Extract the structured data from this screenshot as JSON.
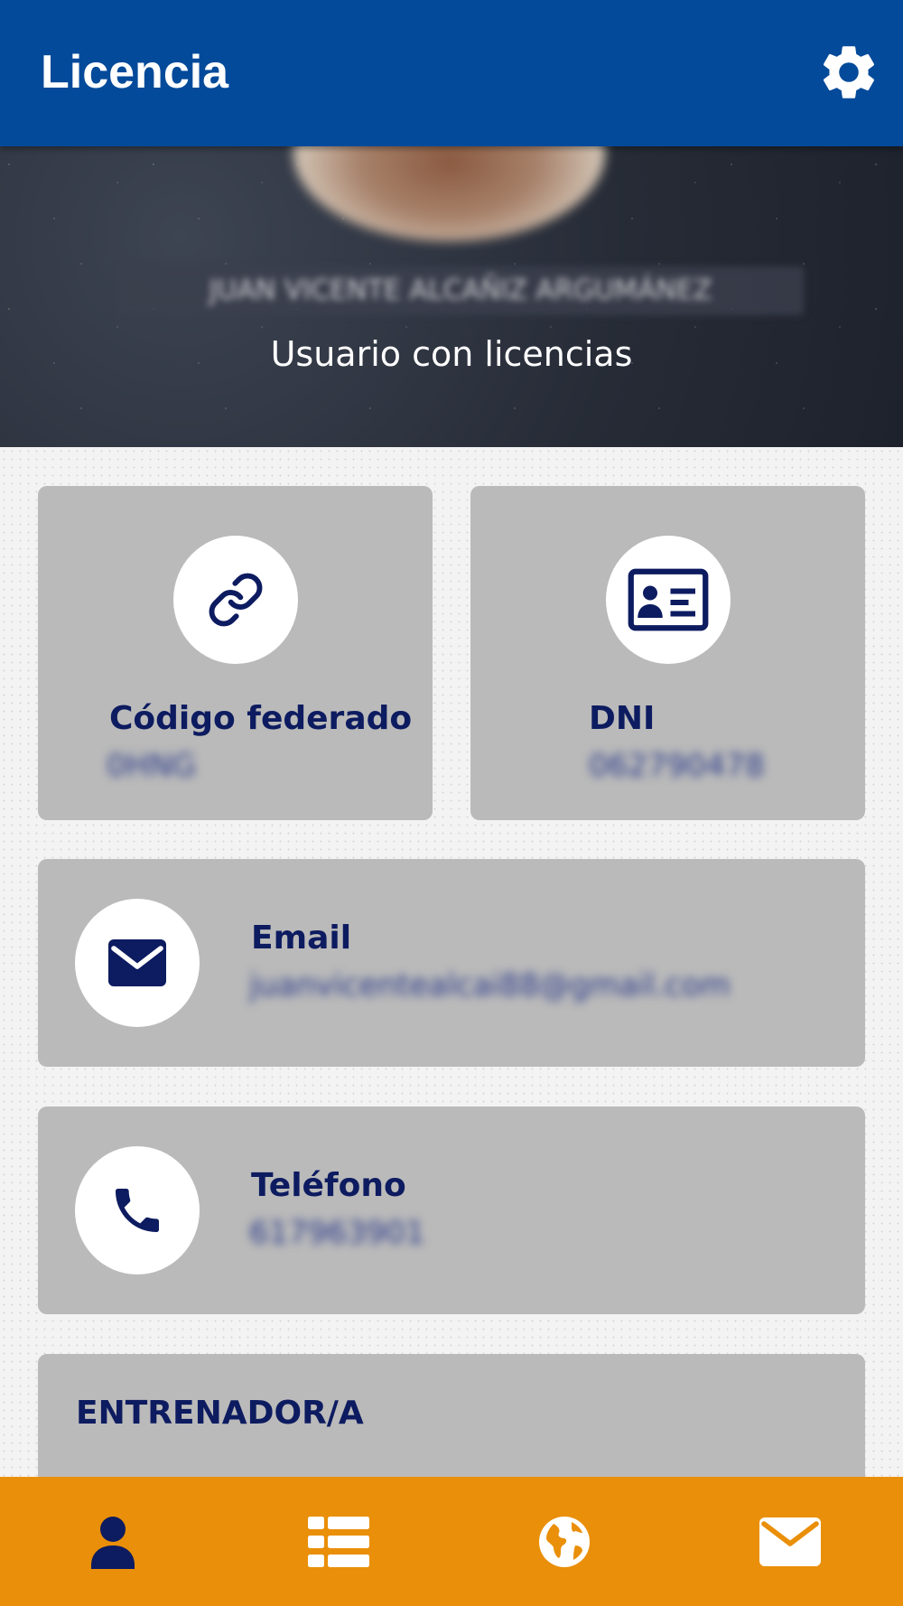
{
  "appbar": {
    "title": "Licencia",
    "settings_icon": "gear-icon"
  },
  "profile": {
    "name": "JUAN VICENTE ALCAÑIZ ARGUMÁNEZ",
    "role": "Usuario con licencias"
  },
  "cards": {
    "federado": {
      "icon": "link-icon",
      "label": "Código federado",
      "value": "0HNG"
    },
    "dni": {
      "icon": "id-card-icon",
      "label": "DNI",
      "value": "062790478"
    },
    "email": {
      "icon": "envelope-icon",
      "label": "Email",
      "value": "juanvicentealcai88@gmail.com"
    },
    "phone": {
      "icon": "phone-icon",
      "label": "Teléfono",
      "value": "617963901"
    },
    "role_card": {
      "label": "ENTRENADOR/A"
    }
  },
  "bottom_nav": [
    {
      "icon": "user-icon",
      "active": true
    },
    {
      "icon": "list-icon",
      "active": false
    },
    {
      "icon": "globe-icon",
      "active": false
    },
    {
      "icon": "mail-icon",
      "active": false
    }
  ],
  "colors": {
    "appbar": "#044a9a",
    "accent": "#ea8f09",
    "card": "#bababa",
    "text": "#0d1b60"
  }
}
